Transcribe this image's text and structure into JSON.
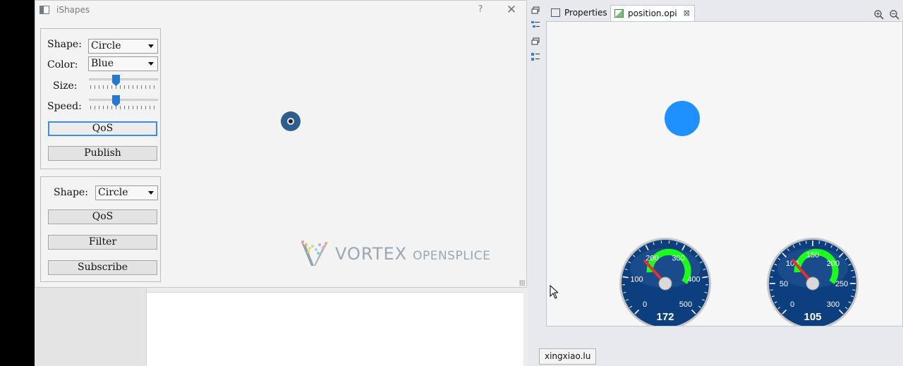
{
  "window": {
    "title": "iShapes",
    "help": "?",
    "close": "✕"
  },
  "publisher": {
    "shape_label": "Shape:",
    "shape_value": "Circle",
    "color_label": "Color:",
    "color_value": "Blue",
    "size_label": "Size:",
    "size_level": 0.38,
    "speed_label": "Speed:",
    "speed_level": 0.38,
    "qos_label": "QoS",
    "publish_label": "Publish"
  },
  "subscriber": {
    "shape_label": "Shape:",
    "shape_value": "Circle",
    "qos_label": "QoS",
    "filter_label": "Filter",
    "subscribe_label": "Subscribe"
  },
  "logo": {
    "brand": "VORTEX",
    "product": "OPENSPLICE"
  },
  "eclipse": {
    "tabs": [
      {
        "label": "Properties"
      },
      {
        "label": "position.opi"
      }
    ],
    "tab_close": "⊠",
    "status_user": "xingxiao.lu"
  },
  "colors": {
    "accent": "#1f7ad6",
    "shape_blue": "#1e90ff",
    "gauge_face": "#0d3f7e",
    "gauge_green": "#1cff1c",
    "gauge_needle": "#e2322d"
  },
  "gauges": [
    {
      "min": 0,
      "max": 500,
      "value": 172,
      "ticks": [
        "0",
        "100",
        "200",
        "300",
        "400",
        "500"
      ],
      "readout": "172"
    },
    {
      "min": 0,
      "max": 300,
      "value": 105,
      "ticks": [
        "0",
        "50",
        "100",
        "150",
        "200",
        "250",
        "300"
      ],
      "readout": "105"
    }
  ]
}
